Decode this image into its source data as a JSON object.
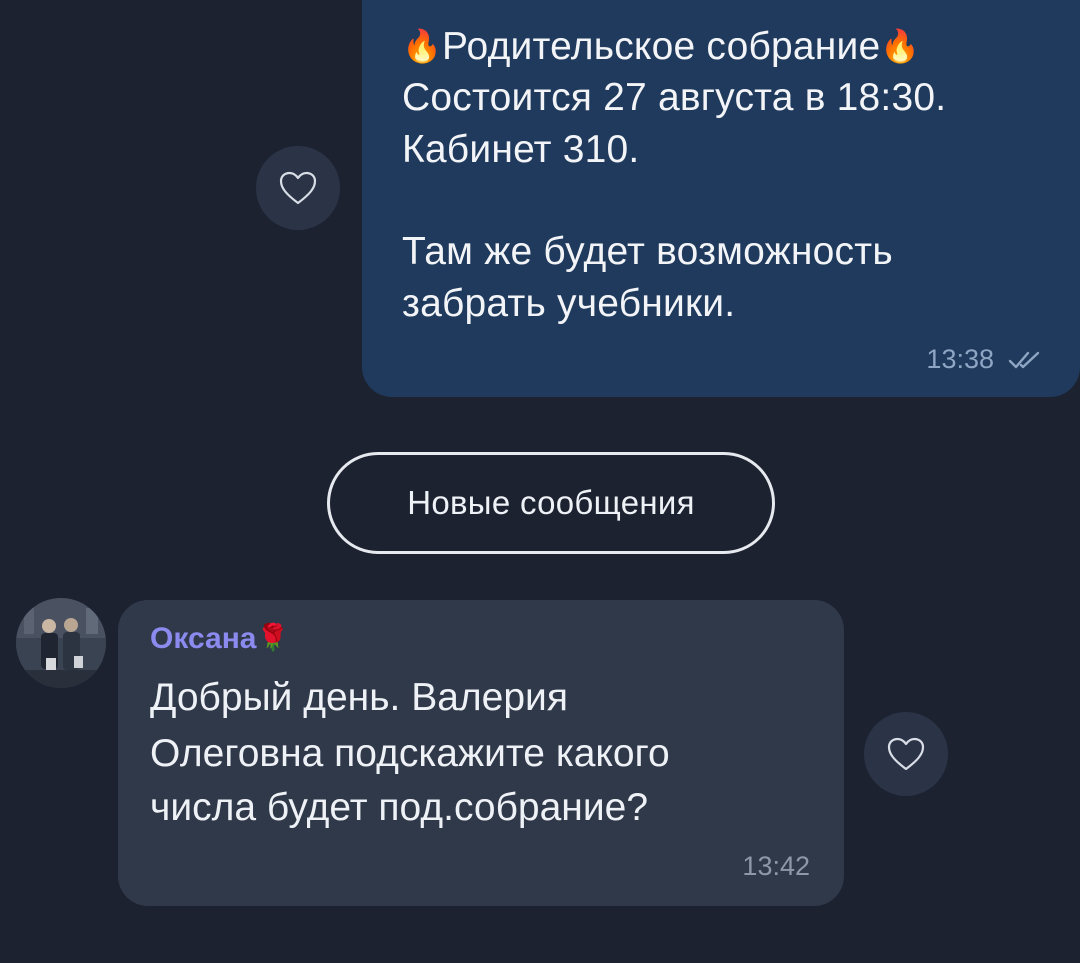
{
  "chat": {
    "outgoing_message": {
      "title": "Родительское собрание",
      "title_emoji": "🔥",
      "lines": [
        "Состоится 27 августа в 18:30.",
        "Кабинет 310.",
        "Там же будет возможность",
        "забрать учебники."
      ],
      "time": "13:38",
      "status_icon": "double-check-icon"
    },
    "divider": {
      "label": "Новые сообщения"
    },
    "incoming_message": {
      "sender": "Оксана",
      "sender_emoji": "🌹",
      "lines": [
        "Добрый день. Валерия",
        "Олеговна подскажите какого",
        "числа будет под.собрание?"
      ],
      "time": "13:42"
    },
    "reaction_icon": "heart-outline-icon"
  },
  "colors": {
    "background": "#1c2230",
    "outgoing_bubble": "#1f3a5c",
    "incoming_bubble": "#30394a",
    "sender_name": "#8b8bef"
  }
}
